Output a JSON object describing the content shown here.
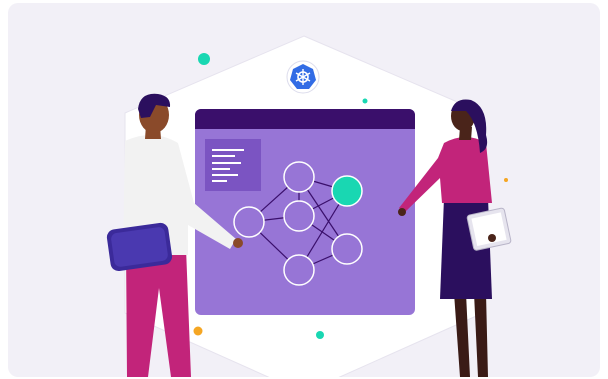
{
  "illustration": {
    "icons": [
      "kubernetes-helm-icon"
    ],
    "colors": {
      "card_background": "#f2f0f7",
      "hexagon": "#ffffff",
      "board": "#9775d6",
      "board_header": "#3a0f6b",
      "text_panel": "#7b54c2",
      "network_node_highlight": "#19d7b2",
      "kubernetes_blue": "#326ce5",
      "accent_orange": "#f5a623",
      "accent_teal": "#19d7b2",
      "man_sweater": "#f2f2f2",
      "man_pants": "#c2247a",
      "laptop": "#3b2a9a",
      "woman_blouse": "#c2247a",
      "woman_skirt": "#2b0f5e"
    }
  }
}
